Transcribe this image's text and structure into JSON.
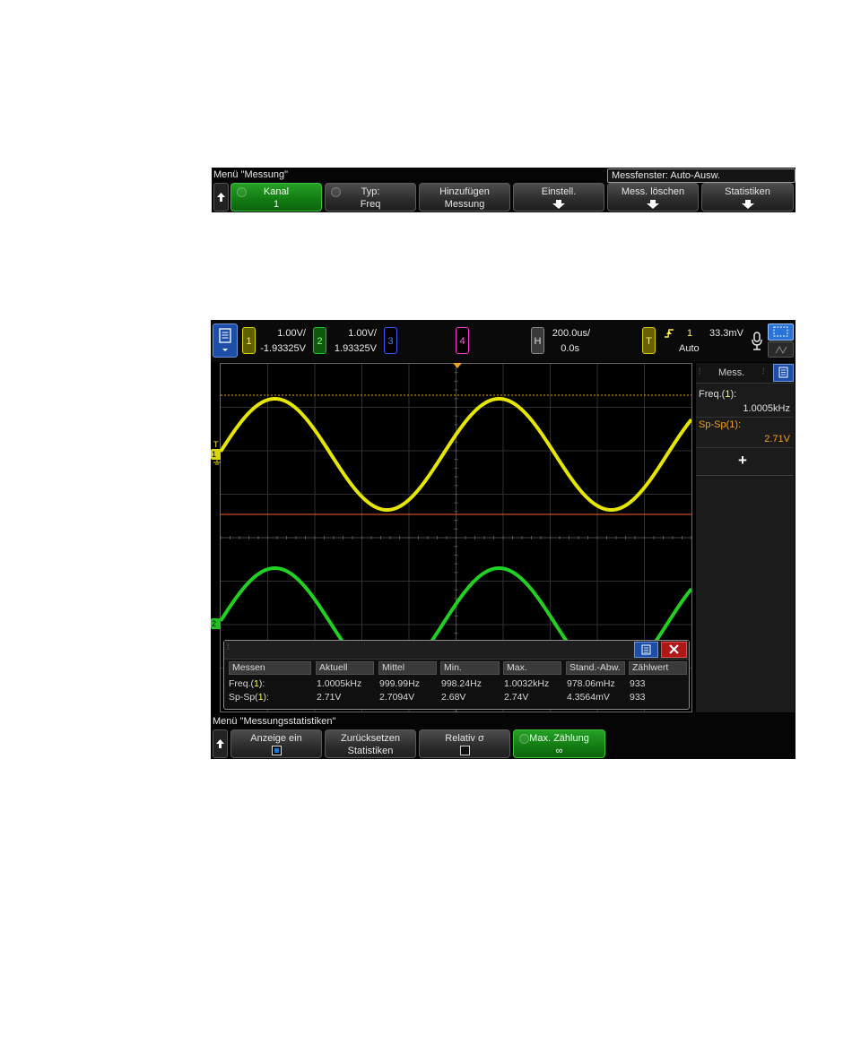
{
  "measure_menu": {
    "title": "Menü \"Messung\"",
    "window_label": "Messfenster: Auto-Ausw.",
    "softkeys": [
      {
        "line1": "Kanal",
        "line2": "1"
      },
      {
        "line1": "Typ:",
        "line2": "Freq"
      },
      {
        "line1": "Hinzufügen",
        "line2": "Messung"
      },
      {
        "line1": "Einstell."
      },
      {
        "line1": "Mess. löschen"
      },
      {
        "line1": "Statistiken"
      }
    ]
  },
  "top_bar": {
    "ch1": {
      "num": "1",
      "scale": "1.00V/",
      "offset": "-1.93325V",
      "color": "#d8d800"
    },
    "ch2": {
      "num": "2",
      "scale": "1.00V/",
      "offset": "1.93325V",
      "color": "#1fbf1f"
    },
    "ch3": {
      "num": "3",
      "color": "#3a55ff"
    },
    "ch4": {
      "num": "4",
      "color": "#ff3bd0"
    },
    "horizontal": {
      "label": "H",
      "scale": "200.0us/",
      "position": "0.0s"
    },
    "trigger": {
      "label": "T",
      "source": "1",
      "level": "33.3mV",
      "mode": "Auto"
    }
  },
  "markers": {
    "ch1_ground": "1",
    "ch1_trigger": "T",
    "ch2_ground": "2"
  },
  "side_panel": {
    "tab_label": "Mess.",
    "items": [
      {
        "name": "Freq.(1):",
        "value": "1.0005kHz"
      },
      {
        "name": "Sp-Sp(1):",
        "value": "2.71V"
      }
    ],
    "add_label": "+"
  },
  "stats_window": {
    "headers": [
      "Messen",
      "Aktuell",
      "Mittel",
      "Min.",
      "Max.",
      "Stand.-Abw.",
      "Zählwert"
    ],
    "rows": [
      [
        "Freq.(1):",
        "1.0005kHz",
        "999.99Hz",
        "998.24Hz",
        "1.0032kHz",
        "978.06mHz",
        "933"
      ],
      [
        "Sp-Sp(1):",
        "2.71V",
        "2.7094V",
        "2.68V",
        "2.74V",
        "4.3564mV",
        "933"
      ]
    ]
  },
  "stats_menu": {
    "title": "Menü \"Messungsstatistiken\"",
    "softkeys": [
      {
        "line1": "Anzeige ein"
      },
      {
        "line1": "Zurücksetzen",
        "line2": "Statistiken"
      },
      {
        "line1": "Relativ σ"
      },
      {
        "line1": "Max. Zählung",
        "line2": "∞"
      }
    ]
  },
  "waveforms": {
    "ch1_color": "#e6e600",
    "ch2_color": "#22d022",
    "trigger_marker_color": "#f0a020",
    "cursor_color": "#ff5a2a"
  }
}
